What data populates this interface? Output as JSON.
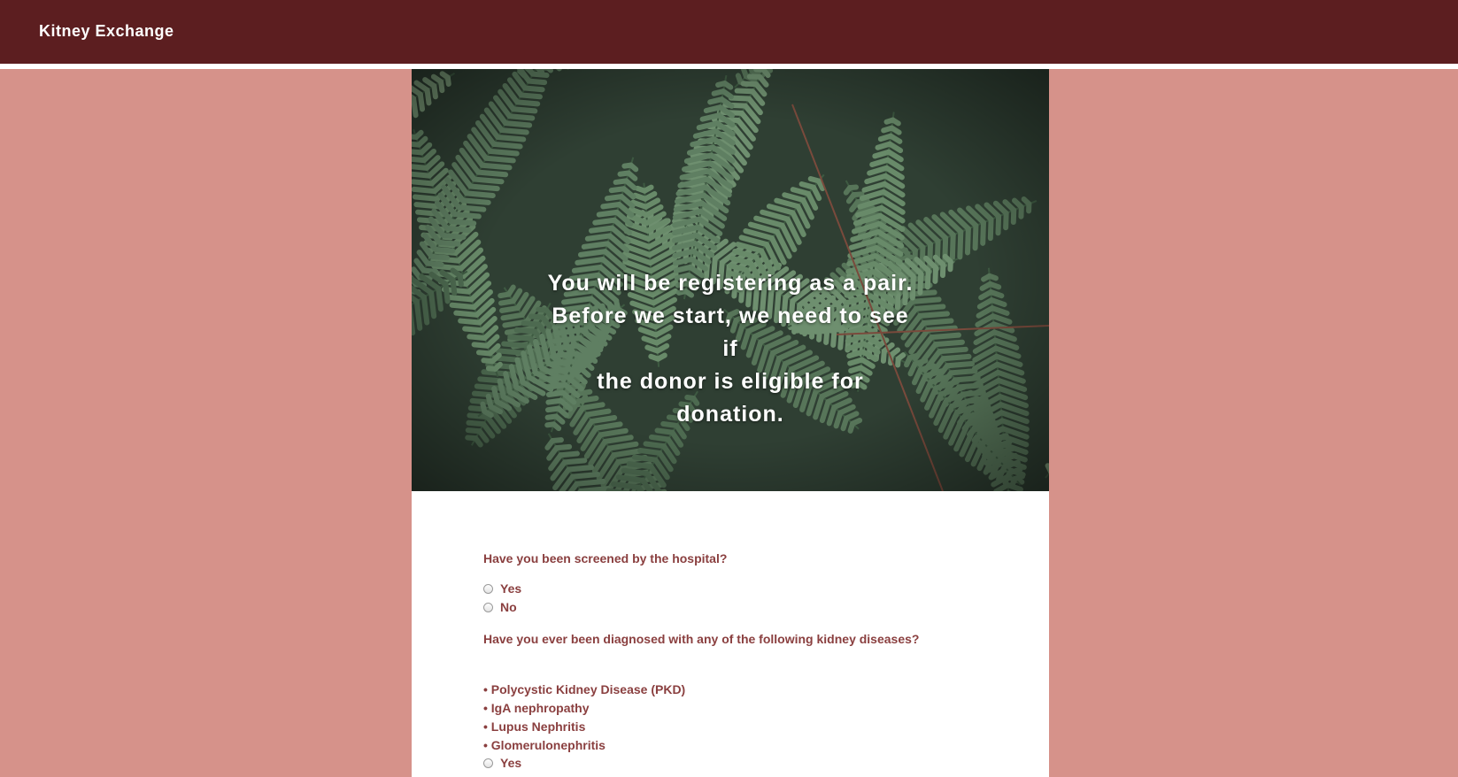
{
  "navbar": {
    "brand": "Kitney Exchange"
  },
  "hero": {
    "line1": "You will be registering as a pair.",
    "line2": "Before we start, we need to see if",
    "line3": "the donor is eligible for donation."
  },
  "form": {
    "q1": {
      "label": "Have you been screened by the hospital?",
      "options": [
        "Yes",
        "No"
      ]
    },
    "q2": {
      "label": "Have you ever been diagnosed with any of the following kidney diseases?",
      "diseases": [
        "• Polycystic Kidney Disease (PKD)",
        "• IgA nephropathy",
        "• Lupus Nephritis",
        "• Glomerulonephritis"
      ],
      "options": [
        "Yes"
      ]
    }
  },
  "colors": {
    "navbar": "#5c1e20",
    "page_background": "#d6928a",
    "form_text": "#8a3f3f"
  }
}
